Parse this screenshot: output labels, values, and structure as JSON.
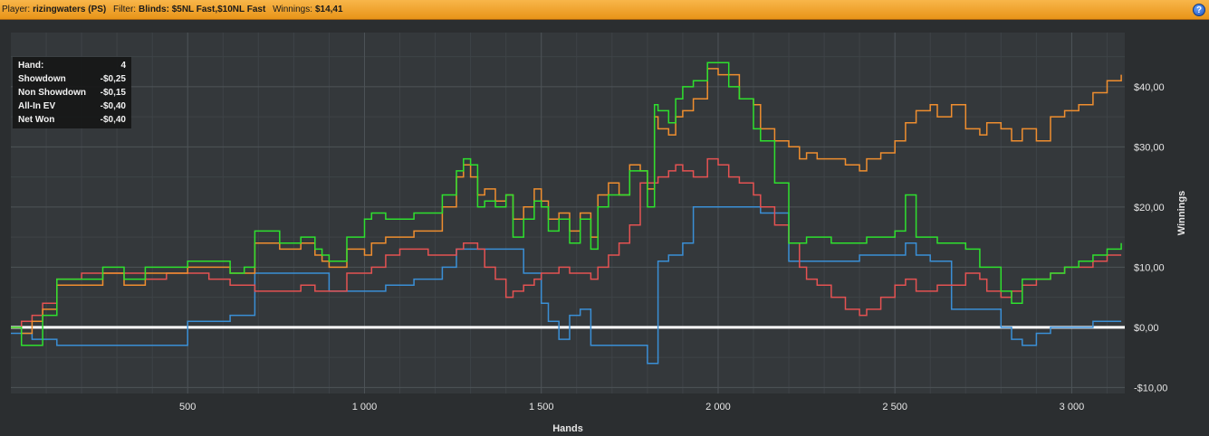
{
  "header": {
    "player_label": "Player:",
    "player": "rizingwaters (PS)",
    "filter_label": "Filter:",
    "filter": "Blinds: $5NL Fast,$10NL Fast",
    "winnings_label": "Winnings:",
    "winnings": "$14,41",
    "help_icon": "?"
  },
  "tooltip": [
    {
      "label": "Hand:",
      "value": "4"
    },
    {
      "label": "Showdown",
      "value": "-$0,25"
    },
    {
      "label": "Non Showdown",
      "value": "-$0,15"
    },
    {
      "label": "All-In EV",
      "value": "-$0,40"
    },
    {
      "label": "Net Won",
      "value": "-$0,40"
    }
  ],
  "chart_data": {
    "type": "line",
    "xlabel": "Hands",
    "ylabel": "Winnings",
    "xlim": [
      0,
      3150
    ],
    "ylim": [
      -11,
      49
    ],
    "xticks": [
      500,
      1000,
      1500,
      2000,
      2500,
      3000
    ],
    "xtick_labels": [
      "500",
      "1 000",
      "1 500",
      "2 000",
      "2 500",
      "3 000"
    ],
    "yticks": [
      -10,
      0,
      10,
      20,
      30,
      40
    ],
    "ytick_labels": [
      "-$10,00",
      "$0,00",
      "$10,00",
      "$20,00",
      "$30,00",
      "$40,00"
    ],
    "grid": true,
    "zero_line_color": "#ffffff",
    "series": [
      {
        "color": "#ef8e2f",
        "x": [
          0,
          30,
          60,
          90,
          130,
          200,
          260,
          320,
          380,
          440,
          500,
          560,
          620,
          660,
          690,
          720,
          760,
          820,
          860,
          880,
          900,
          950,
          1000,
          1020,
          1060,
          1100,
          1140,
          1180,
          1220,
          1260,
          1280,
          1300,
          1320,
          1340,
          1370,
          1400,
          1420,
          1450,
          1480,
          1500,
          1520,
          1550,
          1580,
          1610,
          1640,
          1660,
          1690,
          1720,
          1750,
          1780,
          1800,
          1820,
          1830,
          1860,
          1880,
          1900,
          1930,
          1970,
          2000,
          2030,
          2060,
          2100,
          2120,
          2160,
          2200,
          2230,
          2250,
          2280,
          2320,
          2360,
          2400,
          2420,
          2460,
          2500,
          2530,
          2560,
          2600,
          2620,
          2660,
          2700,
          2740,
          2760,
          2800,
          2830,
          2860,
          2900,
          2940,
          2980,
          3020,
          3060,
          3100,
          3140
        ],
        "y": [
          0,
          -1,
          1,
          3,
          7,
          7,
          9,
          7,
          9,
          9,
          10,
          10,
          9,
          9,
          14,
          14,
          13,
          14,
          12,
          11,
          10,
          13,
          12,
          14,
          15,
          15,
          16,
          16,
          20,
          25,
          27,
          25,
          22,
          23,
          21,
          22,
          18,
          20,
          23,
          21,
          18,
          19,
          16,
          19,
          15,
          22,
          24,
          22,
          27,
          26,
          23,
          35,
          33,
          32,
          35,
          36,
          38,
          43,
          42,
          42,
          38,
          37,
          33,
          31,
          30,
          28,
          29,
          28,
          28,
          27,
          26,
          28,
          29,
          31,
          34,
          36,
          37,
          35,
          37,
          33,
          32,
          34,
          33,
          31,
          33,
          31,
          35,
          36,
          37,
          39,
          41,
          42
        ]
      },
      {
        "color": "#2ee02e",
        "x": [
          0,
          30,
          60,
          90,
          130,
          200,
          260,
          320,
          380,
          440,
          500,
          560,
          620,
          660,
          690,
          720,
          760,
          820,
          860,
          880,
          900,
          950,
          1000,
          1020,
          1060,
          1100,
          1140,
          1180,
          1220,
          1260,
          1280,
          1300,
          1320,
          1340,
          1370,
          1400,
          1420,
          1450,
          1480,
          1500,
          1520,
          1550,
          1580,
          1610,
          1640,
          1660,
          1690,
          1720,
          1750,
          1780,
          1800,
          1820,
          1830,
          1860,
          1880,
          1900,
          1930,
          1970,
          2000,
          2030,
          2060,
          2100,
          2120,
          2160,
          2200,
          2230,
          2250,
          2280,
          2320,
          2360,
          2400,
          2420,
          2460,
          2500,
          2530,
          2560,
          2600,
          2620,
          2660,
          2700,
          2740,
          2760,
          2800,
          2830,
          2860,
          2900,
          2940,
          2980,
          3020,
          3060,
          3100,
          3140
        ],
        "y": [
          0,
          -3,
          -3,
          2,
          8,
          8,
          10,
          8,
          10,
          10,
          11,
          11,
          9,
          10,
          16,
          16,
          14,
          15,
          13,
          12,
          11,
          15,
          18,
          19,
          18,
          18,
          19,
          19,
          22,
          26,
          28,
          27,
          20,
          21,
          20,
          22,
          15,
          18,
          21,
          20,
          16,
          18,
          14,
          18,
          13,
          20,
          22,
          22,
          26,
          26,
          20,
          37,
          36,
          34,
          38,
          40,
          41,
          44,
          44,
          40,
          38,
          33,
          31,
          24,
          14,
          14,
          15,
          15,
          14,
          14,
          14,
          15,
          15,
          16,
          22,
          15,
          15,
          14,
          14,
          13,
          10,
          10,
          6,
          4,
          8,
          8,
          9,
          10,
          11,
          12,
          13,
          14
        ]
      },
      {
        "color": "#e45252",
        "x": [
          0,
          30,
          60,
          90,
          130,
          200,
          260,
          320,
          380,
          440,
          500,
          560,
          620,
          660,
          690,
          720,
          760,
          820,
          860,
          880,
          900,
          950,
          1000,
          1020,
          1060,
          1100,
          1140,
          1180,
          1220,
          1260,
          1280,
          1300,
          1320,
          1340,
          1370,
          1400,
          1420,
          1450,
          1480,
          1500,
          1520,
          1550,
          1580,
          1610,
          1640,
          1660,
          1690,
          1720,
          1750,
          1780,
          1800,
          1820,
          1830,
          1860,
          1880,
          1900,
          1930,
          1970,
          2000,
          2030,
          2060,
          2100,
          2120,
          2160,
          2200,
          2230,
          2250,
          2280,
          2320,
          2360,
          2400,
          2420,
          2460,
          2500,
          2530,
          2560,
          2600,
          2620,
          2660,
          2700,
          2740,
          2760,
          2800,
          2830,
          2860,
          2900,
          2940,
          2980,
          3020,
          3060,
          3100,
          3140
        ],
        "y": [
          0,
          1,
          2,
          4,
          8,
          9,
          9,
          9,
          8,
          9,
          9,
          8,
          7,
          7,
          6,
          6,
          6,
          7,
          6,
          6,
          6,
          9,
          9,
          10,
          12,
          13,
          13,
          12,
          12,
          13,
          14,
          14,
          13,
          10,
          8,
          5,
          6,
          7,
          8,
          9,
          9,
          10,
          9,
          9,
          8,
          10,
          12,
          14,
          17,
          24,
          24,
          24,
          25,
          26,
          27,
          26,
          25,
          28,
          27,
          25,
          24,
          22,
          20,
          17,
          14,
          10,
          8,
          7,
          5,
          3,
          2,
          3,
          5,
          7,
          8,
          6,
          6,
          7,
          7,
          9,
          8,
          6,
          5,
          6,
          7,
          8,
          9,
          10,
          10,
          11,
          12,
          12
        ]
      },
      {
        "color": "#3a8fd6",
        "x": [
          0,
          30,
          60,
          90,
          130,
          200,
          260,
          320,
          380,
          440,
          500,
          560,
          620,
          660,
          690,
          720,
          760,
          820,
          860,
          880,
          900,
          950,
          1000,
          1020,
          1060,
          1100,
          1140,
          1180,
          1220,
          1260,
          1280,
          1300,
          1320,
          1340,
          1370,
          1400,
          1420,
          1450,
          1480,
          1500,
          1520,
          1550,
          1580,
          1610,
          1640,
          1660,
          1690,
          1720,
          1750,
          1780,
          1800,
          1820,
          1830,
          1860,
          1880,
          1900,
          1930,
          1970,
          2000,
          2030,
          2060,
          2100,
          2120,
          2160,
          2200,
          2230,
          2250,
          2280,
          2320,
          2360,
          2400,
          2420,
          2460,
          2500,
          2530,
          2560,
          2600,
          2620,
          2660,
          2700,
          2740,
          2760,
          2800,
          2830,
          2860,
          2900,
          2940,
          2980,
          3020,
          3060,
          3100,
          3140
        ],
        "y": [
          -1,
          -1,
          -2,
          -2,
          -3,
          -3,
          -3,
          -3,
          -3,
          -3,
          1,
          1,
          2,
          2,
          9,
          9,
          9,
          9,
          9,
          9,
          6,
          6,
          6,
          6,
          7,
          7,
          8,
          8,
          10,
          13,
          13,
          13,
          13,
          13,
          13,
          13,
          13,
          9,
          9,
          4,
          1,
          -2,
          2,
          3,
          -3,
          -3,
          -3,
          -3,
          -3,
          -3,
          -6,
          -6,
          11,
          12,
          12,
          14,
          20,
          20,
          20,
          20,
          20,
          20,
          19,
          19,
          11,
          11,
          11,
          11,
          11,
          11,
          12,
          12,
          12,
          12,
          14,
          12,
          11,
          11,
          3,
          3,
          3,
          3,
          0,
          -2,
          -3,
          -1,
          0,
          0,
          0,
          1,
          1,
          1
        ]
      }
    ]
  }
}
